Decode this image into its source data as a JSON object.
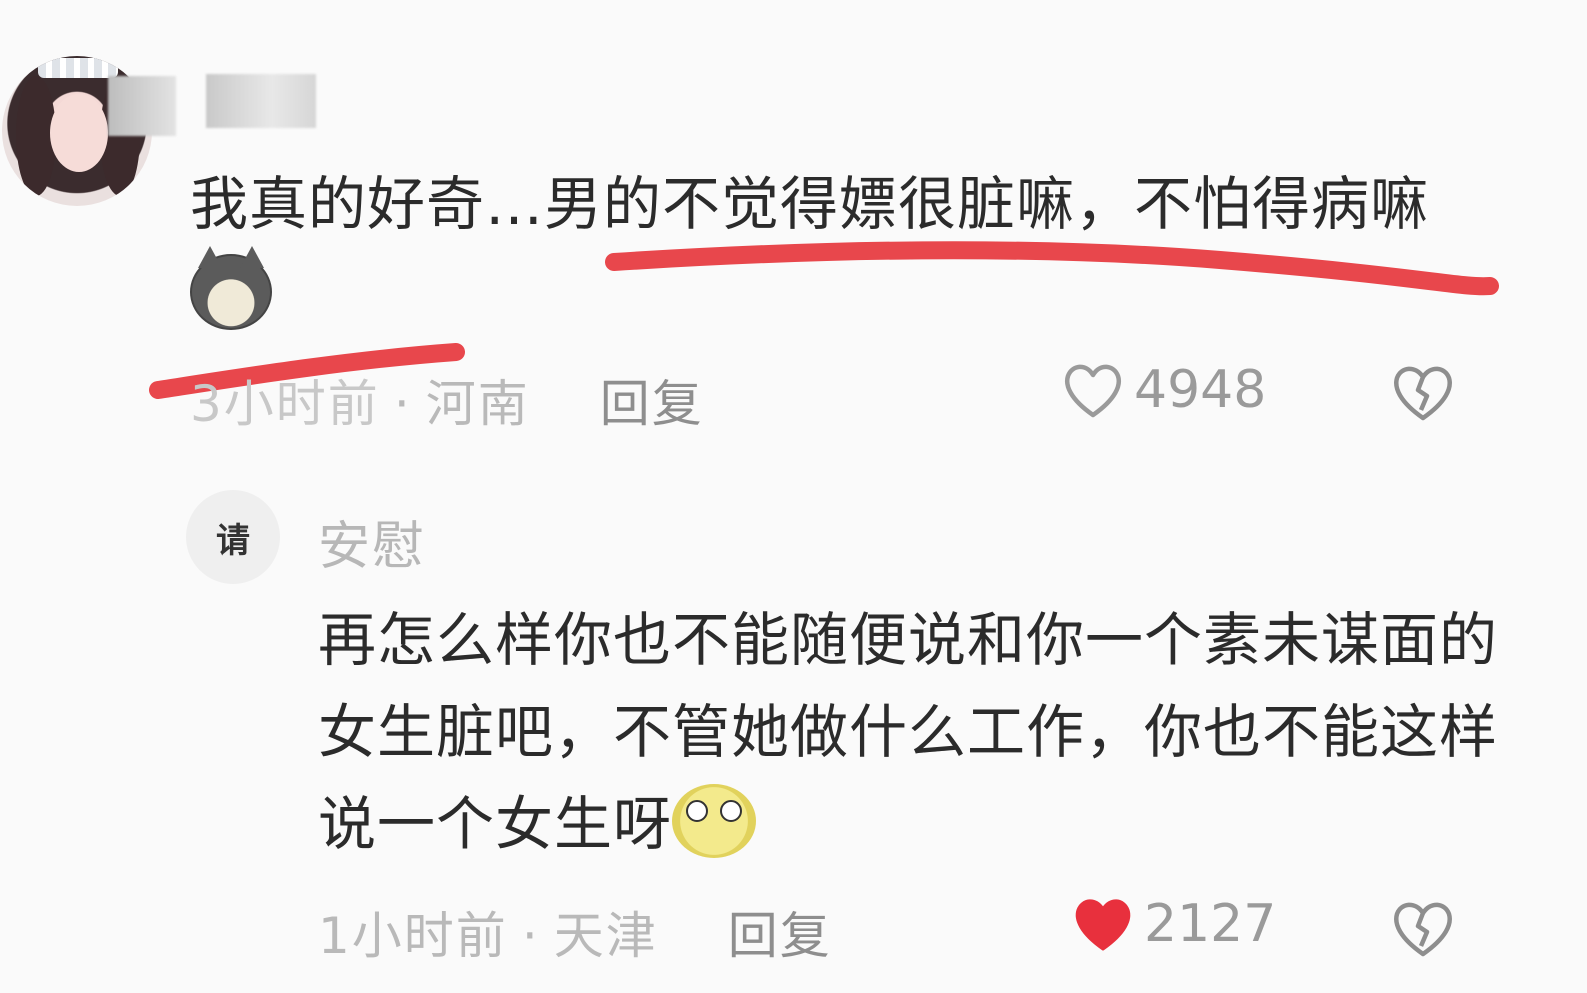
{
  "comment": {
    "text": "我真的好奇…男的不觉得嫖很脏嘛，不怕得病嘛",
    "emoji": "dog-face-emoji",
    "time_partial": "3小时前",
    "location": "河南",
    "reply_label": "回复",
    "likes": "4948",
    "liked": false,
    "annotation_color": "#e8474c"
  },
  "reply": {
    "avatar_text": "请",
    "username": "安慰",
    "text": "再怎么样你也不能随便说和你一个素未谋面的女生脏吧，不管她做什么工作，你也不能这样说一个女生呀",
    "emoji": "surprised-face-emoji",
    "time": "1小时前",
    "location": "天津",
    "reply_label": "回复",
    "likes": "2127",
    "liked": true,
    "like_color": "#e8303d"
  },
  "separator": "·"
}
